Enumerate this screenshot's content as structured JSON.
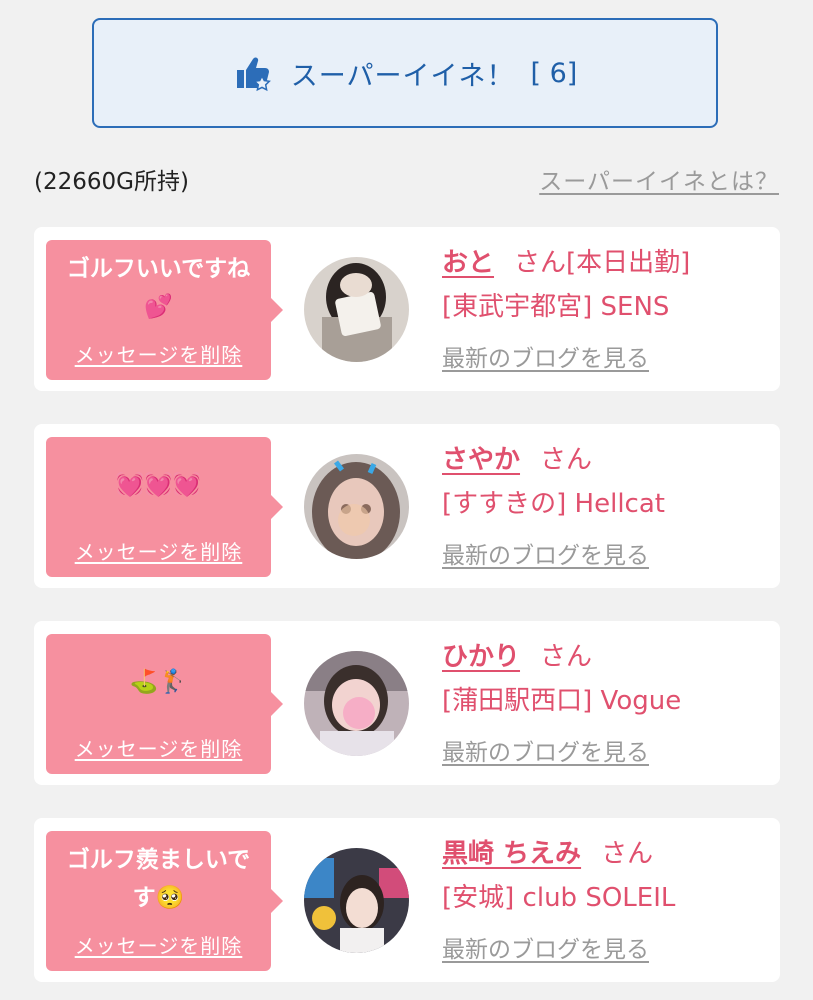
{
  "super_like": {
    "label": "スーパーイイネ！",
    "count": "[ 6]",
    "icon": "thumbs-up-star-icon",
    "accent": "#1f5fa8"
  },
  "balance": "(22660G所持)",
  "what_is_link": "スーパーイイネとは？",
  "cards": [
    {
      "message": "ゴルフいいですね💕",
      "delete_label": "メッセージを削除",
      "name": "おと",
      "honorific": "さん",
      "status": "[本日出勤]",
      "shop": "[東武宇都宮] SENS",
      "blog_link": "最新のブログを見る"
    },
    {
      "message": "💓💓💓",
      "delete_label": "メッセージを削除",
      "name": "さやか",
      "honorific": "さん",
      "status": "",
      "shop": "[すすきの] Hellcat",
      "blog_link": "最新のブログを見る"
    },
    {
      "message": "⛳🏌",
      "delete_label": "メッセージを削除",
      "name": "ひかり",
      "honorific": "さん",
      "status": "",
      "shop": "[蒲田駅西口] Vogue",
      "blog_link": "最新のブログを見る"
    },
    {
      "message": "ゴルフ羨ましいです🥺",
      "delete_label": "メッセージを削除",
      "name": "黒崎 ちえみ",
      "honorific": "さん",
      "status": "",
      "shop": "[安城] club SOLEIL",
      "blog_link": "最新のブログを見る"
    }
  ]
}
